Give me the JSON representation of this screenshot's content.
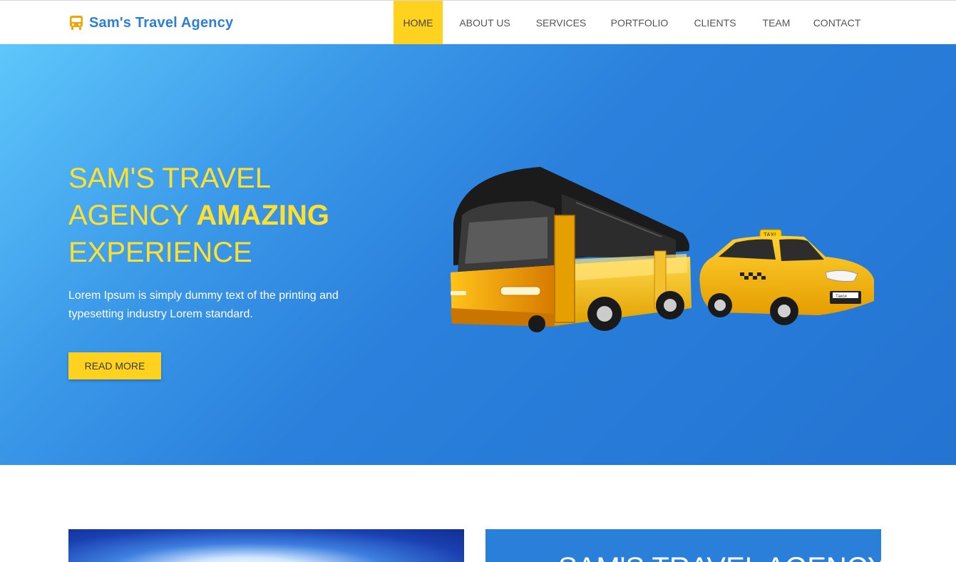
{
  "navbar": {
    "brand": "Sam's Travel Agency",
    "brand_icon": "bus-icon",
    "items": [
      {
        "label": "HOME",
        "active": true
      },
      {
        "label": "ABOUT US",
        "active": false
      },
      {
        "label": "SERVICES",
        "active": false
      },
      {
        "label": "PORTFOLIO",
        "active": false
      },
      {
        "label": "CLIENTS",
        "active": false
      },
      {
        "label": "TEAM",
        "active": false
      },
      {
        "label": "CONTACT",
        "active": false
      }
    ]
  },
  "hero": {
    "title_line1": "SAM'S TRAVEL",
    "title_line2_prefix": "AGENCY ",
    "title_line2_bold": "AMAZING",
    "title_line3": "EXPERIENCE",
    "description": "Lorem Ipsum is simply dummy text of the printing and typesetting industry Lorem standard.",
    "button_label": "READ MORE",
    "taxi_sign": "TAXI",
    "taxi_plate": "Такси"
  },
  "lower": {
    "box_title": "SAM'S TRAVEL AGENCY"
  },
  "colors": {
    "brand_blue": "#2d7fd6",
    "accent_yellow": "#ffd21f",
    "hero_gradient_start": "#5ec7fb",
    "hero_gradient_end": "#2474d2",
    "title_yellow": "#ffe030"
  }
}
